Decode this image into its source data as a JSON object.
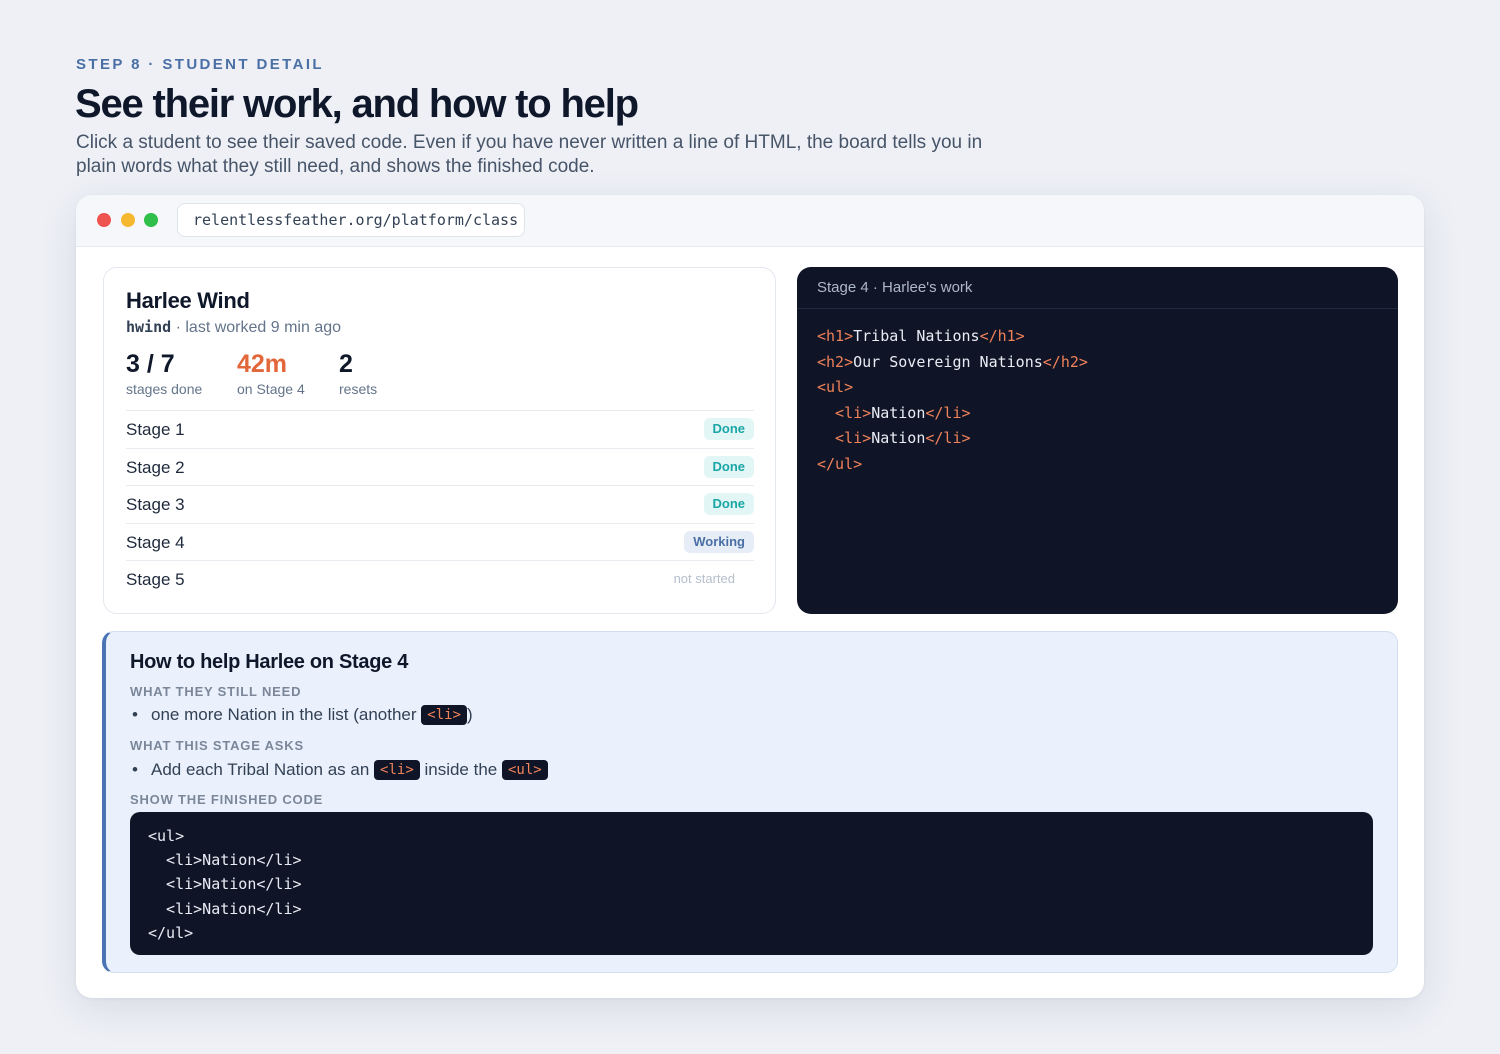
{
  "header": {
    "eyebrow": "STEP 8 · STUDENT DETAIL",
    "title": "See their work, and how to help",
    "lede": "Click a student to see their saved code. Even if you have never written a line of HTML, the board tells you in plain words what they still need, and shows the finished code."
  },
  "browser": {
    "url": "relentlessfeather.org/platform/class"
  },
  "student": {
    "name": "Harlee Wind",
    "handle": "hwind",
    "last_worked": " · last worked 9 min ago",
    "stats": [
      {
        "value": "3 / 7",
        "label": "stages done"
      },
      {
        "value": "42m",
        "label": "on Stage 4"
      },
      {
        "value": "2",
        "label": "resets"
      }
    ],
    "stages": [
      {
        "name": "Stage 1",
        "status": "Done"
      },
      {
        "name": "Stage 2",
        "status": "Done"
      },
      {
        "name": "Stage 3",
        "status": "Done"
      },
      {
        "name": "Stage 4",
        "status": "Working"
      },
      {
        "name": "Stage 5",
        "status": "not started"
      }
    ]
  },
  "work": {
    "title": "Stage 4 · Harlee's work",
    "lines": [
      {
        "open": "<h1>",
        "text": "Tribal Nations",
        "close": "</h1>"
      },
      {
        "open": "<h2>",
        "text": "Our Sovereign Nations",
        "close": "</h2>"
      },
      {
        "open": "<ul>",
        "text": "",
        "close": ""
      },
      {
        "open": "  <li>",
        "text": "Nation",
        "close": "</li>"
      },
      {
        "open": "  <li>",
        "text": "Nation",
        "close": "</li>"
      },
      {
        "open": "</ul>",
        "text": "",
        "close": ""
      }
    ]
  },
  "help": {
    "title": "How to help Harlee on Stage 4",
    "need_label": "WHAT THEY STILL NEED",
    "need_text": "one more Nation in the list (another ",
    "need_chip": "<li>",
    "need_end": ")",
    "asks_label": "WHAT THIS STAGE ASKS",
    "asks_text_1": "Add each Tribal Nation as an ",
    "asks_chip_1": "<li>",
    "asks_text_2": " inside the ",
    "asks_chip_2": "<ul>",
    "finished_label": "SHOW THE FINISHED CODE",
    "finished_code": "<ul>\n  <li>Nation</li>\n  <li>Nation</li>\n  <li>Nation</li>\n</ul>"
  },
  "colors": {
    "accent_blue": "#4a6fa5",
    "accent_orange": "#e2673a",
    "done_teal": "#1aa6a6",
    "code_bg": "#0f1526"
  }
}
